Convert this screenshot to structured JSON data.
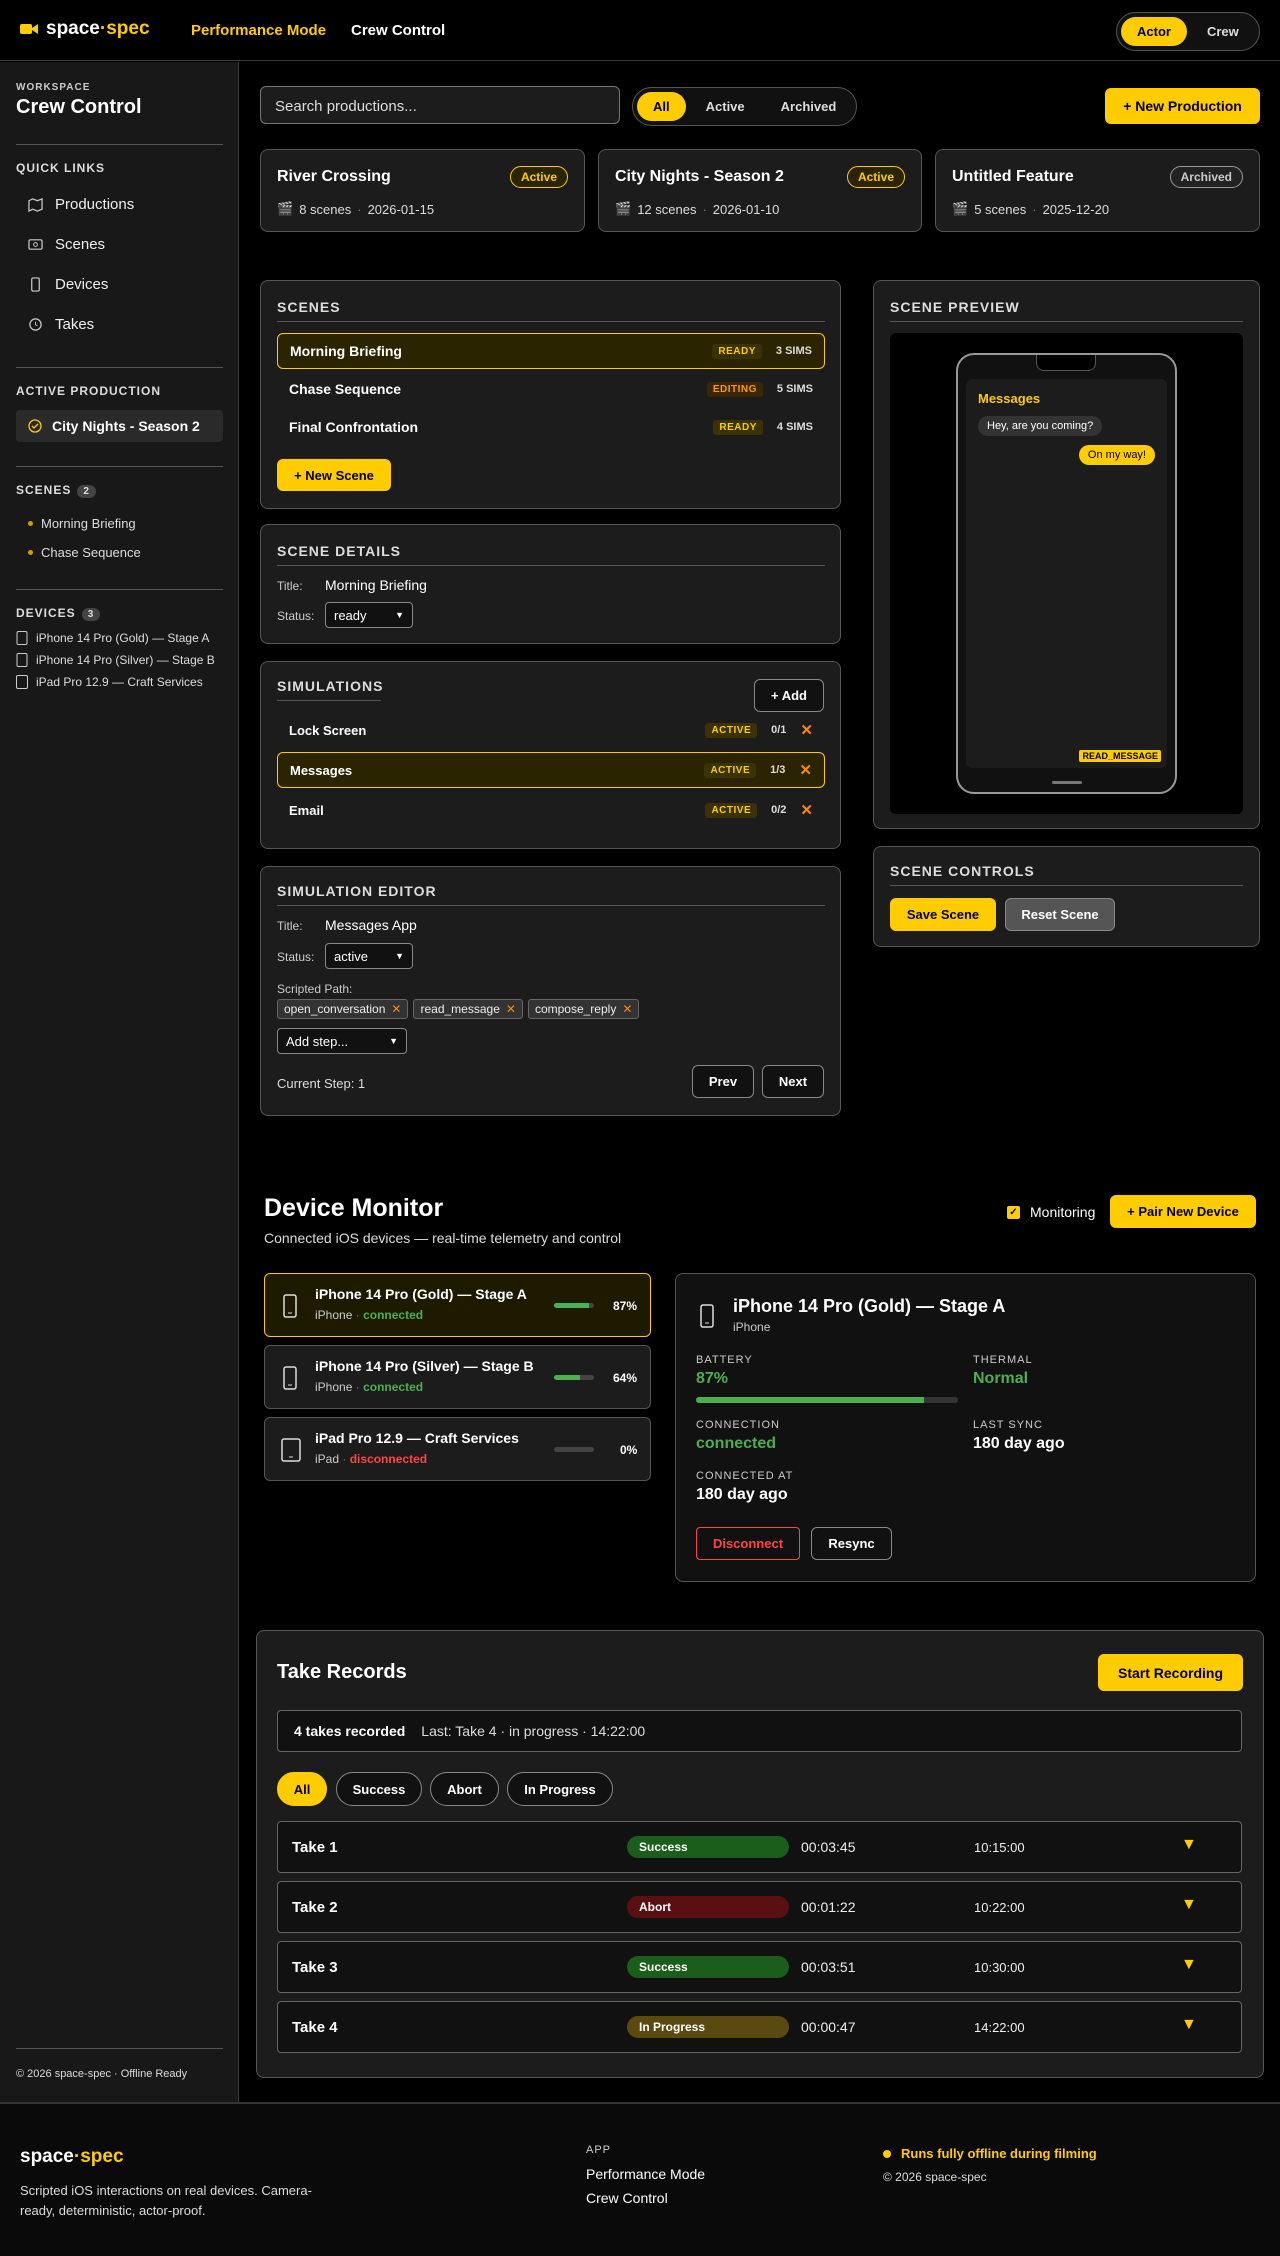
{
  "brand": {
    "name_a": "space",
    "dot": "·",
    "name_b": "spec"
  },
  "nav": {
    "perf": "Performance Mode",
    "crew": "Crew Control"
  },
  "role": {
    "actor": "Actor",
    "crew": "Crew"
  },
  "sidebar": {
    "workspace": "WORKSPACE",
    "title": "Crew Control",
    "quick_links_h": "QUICK LINKS",
    "links": [
      "Productions",
      "Scenes",
      "Devices",
      "Takes"
    ],
    "active_h": "ACTIVE PRODUCTION",
    "active": "City Nights - Season 2",
    "scenes_h": "SCENES",
    "scenes_count": "2",
    "scenes": [
      "Morning Briefing",
      "Chase Sequence"
    ],
    "devices_h": "DEVICES",
    "devices_count": "3",
    "devices": [
      "iPhone 14 Pro (Gold) — Stage A",
      "iPhone 14 Pro (Silver) — Stage B",
      "iPad Pro 12.9 — Craft Services"
    ],
    "footer": "© 2026 space-spec · Offline Ready"
  },
  "toolbar": {
    "search_placeholder": "Search productions...",
    "filters": [
      "All",
      "Active",
      "Archived"
    ],
    "new_prod": "+ New Production"
  },
  "productions": [
    {
      "title": "River Crossing",
      "status": "Active",
      "scenes": "8 scenes",
      "date": "2026-01-15"
    },
    {
      "title": "City Nights - Season 2",
      "status": "Active",
      "scenes": "12 scenes",
      "date": "2026-01-10"
    },
    {
      "title": "Untitled Feature",
      "status": "Archived",
      "scenes": "5 scenes",
      "date": "2025-12-20"
    }
  ],
  "scenes": {
    "title": "SCENES",
    "items": [
      {
        "name": "Morning Briefing",
        "status": "READY",
        "sims": "3 SIMS"
      },
      {
        "name": "Chase Sequence",
        "status": "EDITING",
        "sims": "5 SIMS"
      },
      {
        "name": "Final Confrontation",
        "status": "READY",
        "sims": "4 SIMS"
      }
    ],
    "new": "+ New Scene"
  },
  "scene_details": {
    "title": "SCENE DETAILS",
    "title_lbl": "Title:",
    "title_val": "Morning Briefing",
    "status_lbl": "Status:",
    "status_val": "ready"
  },
  "sims": {
    "title": "SIMULATIONS",
    "add": "+ Add",
    "items": [
      {
        "name": "Lock Screen",
        "status": "ACTIVE",
        "prog": "0/1"
      },
      {
        "name": "Messages",
        "status": "ACTIVE",
        "prog": "1/3"
      },
      {
        "name": "Email",
        "status": "ACTIVE",
        "prog": "0/2"
      }
    ]
  },
  "sim_editor": {
    "title": "SIMULATION EDITOR",
    "title_lbl": "Title:",
    "title_val": "Messages App",
    "status_lbl": "Status:",
    "status_val": "active",
    "path_lbl": "Scripted Path:",
    "steps": [
      "open_conversation",
      "read_message",
      "compose_reply"
    ],
    "add_step": "Add step...",
    "current": "Current Step: 1",
    "prev": "Prev",
    "next": "Next"
  },
  "preview": {
    "title": "SCENE PREVIEW",
    "app": "Messages",
    "in_msg": "Hey, are you coming?",
    "out_msg": "On my way!",
    "badge": "READ_MESSAGE"
  },
  "controls": {
    "title": "SCENE CONTROLS",
    "save": "Save Scene",
    "reset": "Reset Scene"
  },
  "monitor": {
    "title": "Device Monitor",
    "subtitle": "Connected iOS devices — real-time telemetry and control",
    "monitoring": "Monitoring",
    "pair": "+ Pair New Device",
    "devices": [
      {
        "name": "iPhone 14 Pro (Gold) — Stage A",
        "type": "iPhone",
        "conn": "connected",
        "battery": "87%",
        "level": 0.87
      },
      {
        "name": "iPhone 14 Pro (Silver) — Stage B",
        "type": "iPhone",
        "conn": "connected",
        "battery": "64%",
        "level": 0.64
      },
      {
        "name": "iPad Pro 12.9 — Craft Services",
        "type": "iPad",
        "conn": "disconnected",
        "battery": "0%",
        "level": 0
      }
    ],
    "detail": {
      "name": "iPhone 14 Pro (Gold) — Stage A",
      "type": "iPhone",
      "battery_h": "BATTERY",
      "battery": "87%",
      "battery_level": 0.87,
      "thermal_h": "THERMAL",
      "thermal": "Normal",
      "conn_h": "CONNECTION",
      "conn": "connected",
      "sync_h": "LAST SYNC",
      "sync": "180 day ago",
      "at_h": "CONNECTED AT",
      "at": "180 day ago",
      "disconnect": "Disconnect",
      "resync": "Resync"
    }
  },
  "takes": {
    "title": "Take Records",
    "start": "Start Recording",
    "summary_a": "4 takes recorded",
    "summary_b": "Last: Take 4 · in progress · 14:22:00",
    "filters": [
      "All",
      "Success",
      "Abort",
      "In Progress"
    ],
    "rows": [
      {
        "name": "Take 1",
        "status": "Success",
        "dur": "00:03:45",
        "time": "10:15:00"
      },
      {
        "name": "Take 2",
        "status": "Abort",
        "dur": "00:01:22",
        "time": "10:22:00"
      },
      {
        "name": "Take 3",
        "status": "Success",
        "dur": "00:03:51",
        "time": "10:30:00"
      },
      {
        "name": "Take 4",
        "status": "In Progress",
        "dur": "00:00:47",
        "time": "14:22:00"
      }
    ]
  },
  "footer": {
    "tagline": "Scripted iOS interactions on real devices. Camera-ready, deterministic, actor-proof.",
    "app_h": "APP",
    "links": [
      "Performance Mode",
      "Crew Control"
    ],
    "offline": "Runs fully offline during filming",
    "copy": "© 2026 space-spec"
  },
  "colors": {
    "accent": "#ffcc00",
    "success": "#4caf50",
    "danger": "#ff4444"
  }
}
